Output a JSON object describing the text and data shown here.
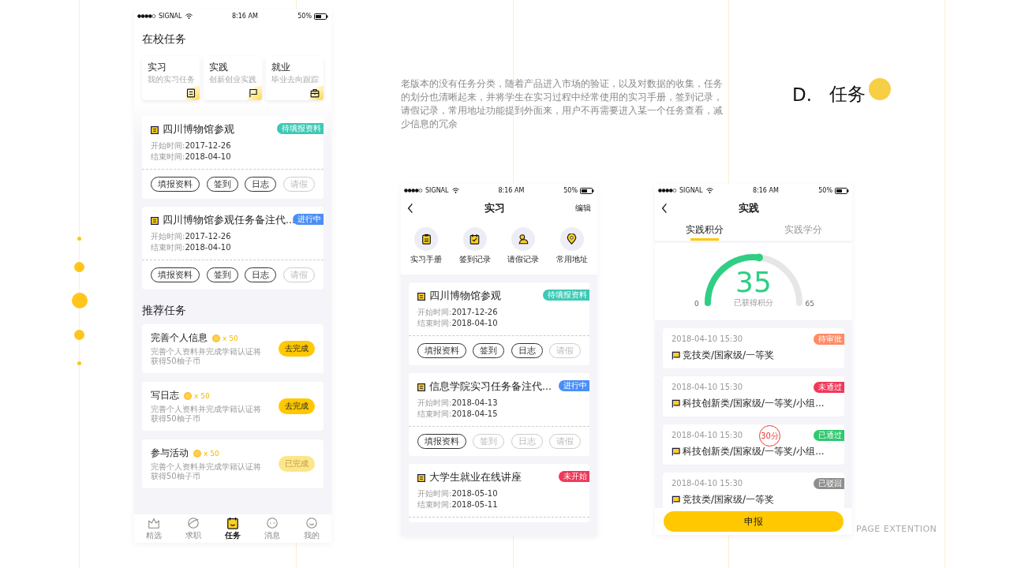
{
  "slide": {
    "description": "老版本的没有任务分类，随着产品进入市场的验证，以及对数据的收集，任务的划分也清晰起来，并将学生在实习过程中经常使用的实习手册，签到记录，请假记录，常用地址功能提到外面来，用户不再需要进入某一个任务查看，减少信息的冗余",
    "section_letter": "D.",
    "section_title": "任务",
    "footer": "PAGE EXTENTION"
  },
  "status_bars": [
    {
      "carrier": "SIGNAL",
      "time": "8:16 AM",
      "battery": "50%"
    },
    {
      "carrier": "SIGNAL",
      "time": "8:16 AM",
      "battery": "50%"
    },
    {
      "carrier": "SIGNAL",
      "time": "8:16 AM",
      "battery": "50%"
    }
  ],
  "task_home": {
    "title": "在校任务",
    "categories": [
      {
        "title": "实习",
        "subtitle": "我的实习任务",
        "kind": "notebook"
      },
      {
        "title": "实践",
        "subtitle": "创新创业实践",
        "kind": "flag"
      },
      {
        "title": "就业",
        "subtitle": "毕业去向跟踪",
        "kind": "briefcase"
      }
    ],
    "tasks": [
      {
        "title": "四川博物馆参观",
        "status": "待填报资料",
        "color": "#3cc9b5",
        "dates": [
          {
            "label": "开始时间:",
            "value": "2017-12-26"
          },
          {
            "label": "结束时间:",
            "value": "2018-04-10"
          }
        ],
        "actions": [
          {
            "label": "填报资料",
            "enabled": true
          },
          {
            "label": "签到",
            "enabled": true
          },
          {
            "label": "日志",
            "enabled": true
          },
          {
            "label": "请假",
            "enabled": false
          }
        ]
      },
      {
        "title": "四川博物馆参观任务备注代...",
        "status": "进行中",
        "color": "#4a8ff7",
        "dates": [
          {
            "label": "开始时间:",
            "value": "2017-12-26"
          },
          {
            "label": "结束时间:",
            "value": "2018-04-10"
          }
        ],
        "actions": [
          {
            "label": "填报资料",
            "enabled": true
          },
          {
            "label": "签到",
            "enabled": true
          },
          {
            "label": "日志",
            "enabled": true
          },
          {
            "label": "请假",
            "enabled": false
          }
        ]
      }
    ],
    "recommend_title": "推荐任务",
    "recommended": [
      {
        "title": "完善个人信息",
        "reward": "x 50",
        "description": "完善个人资料并完成学籍认证将获得50柚子币",
        "button": "去完成",
        "done": false
      },
      {
        "title": "写日志",
        "reward": "x 50",
        "description": "完善个人资料并完成学籍认证将获得50柚子币",
        "button": "去完成",
        "done": false
      },
      {
        "title": "参与活动",
        "reward": "x 50",
        "description": "完善个人资料并完成学籍认证将获得50柚子币",
        "button": "已完成",
        "done": true
      }
    ],
    "tab_bar": [
      {
        "label": "精选",
        "kind": "crown",
        "selected": false
      },
      {
        "label": "求职",
        "kind": "planet",
        "selected": false
      },
      {
        "label": "任务",
        "kind": "calendar",
        "selected": true
      },
      {
        "label": "消息",
        "kind": "chat",
        "selected": false
      },
      {
        "label": "我的",
        "kind": "face",
        "selected": false
      }
    ]
  },
  "internship": {
    "title": "实习",
    "edit": "编辑",
    "shortcuts": [
      {
        "label": "实习手册",
        "kind": "clipboard"
      },
      {
        "label": "签到记录",
        "kind": "calendar"
      },
      {
        "label": "请假记录",
        "kind": "person"
      },
      {
        "label": "常用地址",
        "kind": "pin"
      }
    ],
    "tasks": [
      {
        "title": "四川博物馆参观",
        "status": "待填报资料",
        "color": "#3cc9b5",
        "dates": [
          {
            "label": "开始时间:",
            "value": "2017-12-26"
          },
          {
            "label": "结束时间:",
            "value": "2018-04-10"
          }
        ],
        "actions": [
          {
            "label": "填报资料",
            "enabled": true
          },
          {
            "label": "签到",
            "enabled": true
          },
          {
            "label": "日志",
            "enabled": true
          },
          {
            "label": "请假",
            "enabled": false
          }
        ]
      },
      {
        "title": "信息学院实习任务备注代...",
        "status": "进行中",
        "color": "#4a8ff7",
        "dates": [
          {
            "label": "开始时间:",
            "value": "2018-04-13"
          },
          {
            "label": "结束时间:",
            "value": "2018-04-15"
          }
        ],
        "actions": [
          {
            "label": "填报资料",
            "enabled": true
          },
          {
            "label": "签到",
            "enabled": false
          },
          {
            "label": "日志",
            "enabled": false
          },
          {
            "label": "请假",
            "enabled": false
          }
        ]
      },
      {
        "title": "大学生就业在线讲座",
        "status": "未开始",
        "color": "#f0385a",
        "dates": [
          {
            "label": "开始时间:",
            "value": "2018-05-10"
          },
          {
            "label": "结束时间:",
            "value": "2018-05-11"
          }
        ]
      }
    ]
  },
  "practice": {
    "title": "实践",
    "tabs": [
      {
        "label": "实践积分",
        "selected": true
      },
      {
        "label": "实践学分",
        "selected": false
      }
    ],
    "gauge": {
      "value": "35",
      "caption": "已获得积分",
      "min": "0",
      "max": "65"
    },
    "records": [
      {
        "time": "2018-04-10  15:30",
        "title": "竞技类/国家级/一等奖",
        "status": "待审批",
        "color": "#ff8a65"
      },
      {
        "time": "2018-04-10  15:30",
        "title": "科技创新类/国家级/一等奖/小组...",
        "status": "未通过",
        "color": "#f0385a"
      },
      {
        "time": "2018-04-10  15:30",
        "title": "科技创新类/国家级/一等奖/小组...",
        "status": "已通过",
        "color": "#2fc870",
        "stamp": "30分"
      },
      {
        "time": "2018-04-10  15:30",
        "title": "竞技类/国家级/一等奖",
        "status": "已驳回",
        "color": "#8e8e8e"
      }
    ],
    "submit": "申报"
  }
}
